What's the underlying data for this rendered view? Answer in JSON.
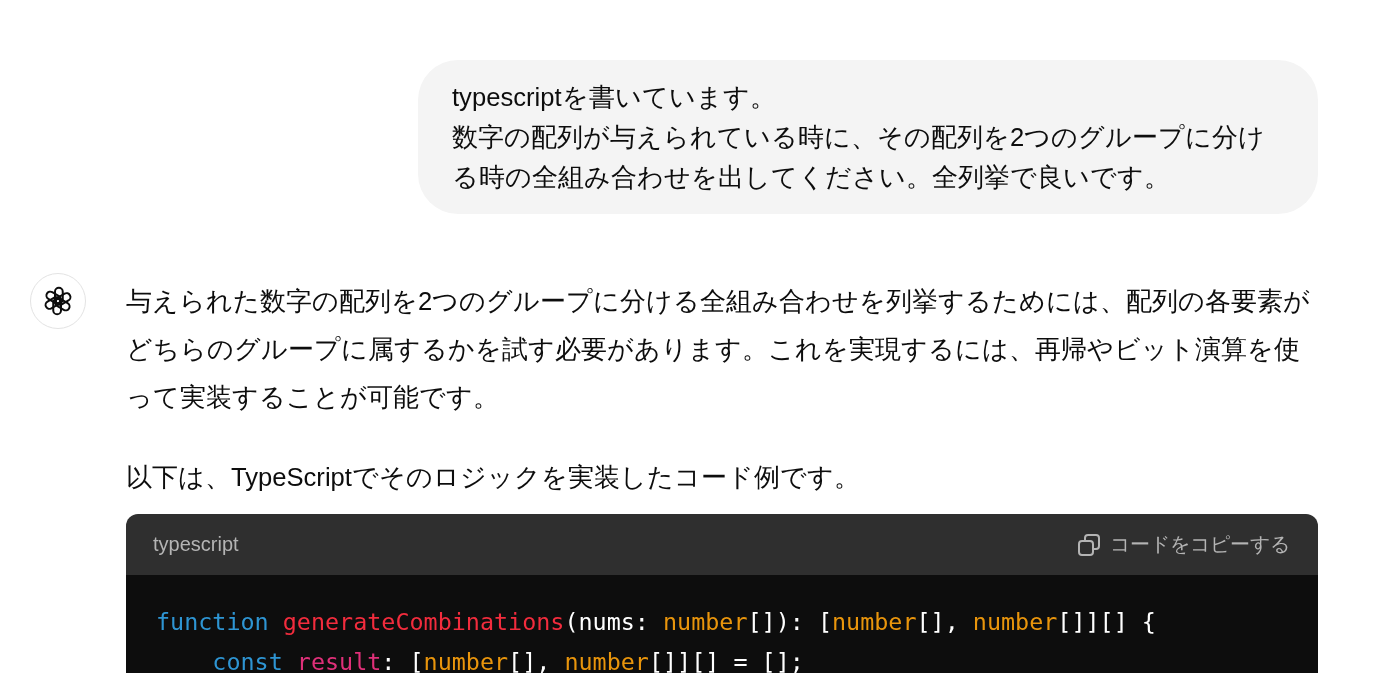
{
  "user_message": {
    "lines": [
      "typescriptを書いています。",
      "数字の配列が与えられている時に、その配列を2つのグループに分ける時の全組み合わせを出してください。全列挙で良いです。"
    ]
  },
  "assistant_message": {
    "paragraphs": [
      "与えられた数字の配列を2つのグループに分ける全組み合わせを列挙するためには、配列の各要素がどちらのグループに属するかを試す必要があります。これを実現するには、再帰やビット演算を使って実装することが可能です。",
      "以下は、TypeScriptでそのロジックを実装したコード例です。"
    ],
    "code_block": {
      "language": "typescript",
      "copy_label": "コードをコピーする",
      "lines": [
        {
          "tokens": [
            {
              "kind": "keyword",
              "text": "function"
            },
            {
              "kind": "function",
              "text": " generateCombinations"
            },
            {
              "kind": "plain",
              "text": "(nums: "
            },
            {
              "kind": "type",
              "text": "number"
            },
            {
              "kind": "plain",
              "text": "[]): ["
            },
            {
              "kind": "type",
              "text": "number"
            },
            {
              "kind": "plain",
              "text": "[], "
            },
            {
              "kind": "type",
              "text": "number"
            },
            {
              "kind": "plain",
              "text": "[]][] {"
            }
          ]
        },
        {
          "tokens": [
            {
              "kind": "keyword",
              "text": "    const"
            },
            {
              "kind": "variable",
              "text": " result"
            },
            {
              "kind": "plain",
              "text": ": ["
            },
            {
              "kind": "type",
              "text": "number"
            },
            {
              "kind": "plain",
              "text": "[], "
            },
            {
              "kind": "type",
              "text": "number"
            },
            {
              "kind": "plain",
              "text": "[]][] = [];"
            }
          ]
        }
      ]
    }
  }
}
